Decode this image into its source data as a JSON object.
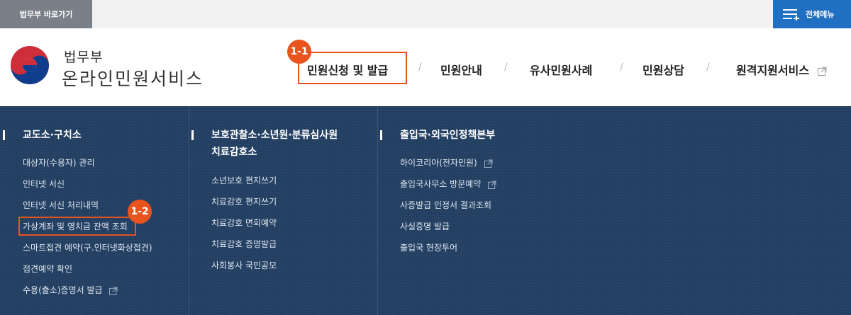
{
  "topbar": {
    "moj_link": "법무부 바로가기",
    "all_menu": "전체메뉴"
  },
  "header": {
    "org_small": "법무부",
    "org_title": "온라인민원서비스"
  },
  "gnb": {
    "items": [
      "민원신청 및 발급",
      "민원안내",
      "유사민원사례",
      "민원상담",
      "원격지원서비스"
    ]
  },
  "annotations": {
    "badge1": "1-1",
    "badge2": "1-2"
  },
  "columns": [
    {
      "heading": "교도소·구치소",
      "items": [
        "대상자(수용자) 관리",
        "인터넷 서신",
        "인터넷 서신 처리내역",
        "가상계좌 및 영치금 잔액 조회",
        "스마트접견 예약(구.인터넷화상접견)",
        "접견예약 확인",
        "수용(출소)증명서 발급"
      ]
    },
    {
      "heading_line1": "보호관찰소·소년원·분류심사원",
      "heading_line2": "치료감호소",
      "items": [
        "소년보호 편지쓰기",
        "치료감호 편지쓰기",
        "치료감호 면회예약",
        "치료감호 증명발급",
        "사회봉사 국민공모"
      ]
    },
    {
      "heading": "출입국·외국인정책본부",
      "items": [
        "하이코리아(전자민원)",
        "출입국사무소 방문예약",
        "사증발급 인정서 결과조회",
        "사실증명 발급",
        "출입국 현장투어"
      ]
    }
  ],
  "colors": {
    "accent": "#e8531e",
    "panel": "#234063",
    "menu_button": "#1f6fc2"
  },
  "icons": {
    "external": "external-link-icon",
    "menu": "menu-lines-icon"
  }
}
